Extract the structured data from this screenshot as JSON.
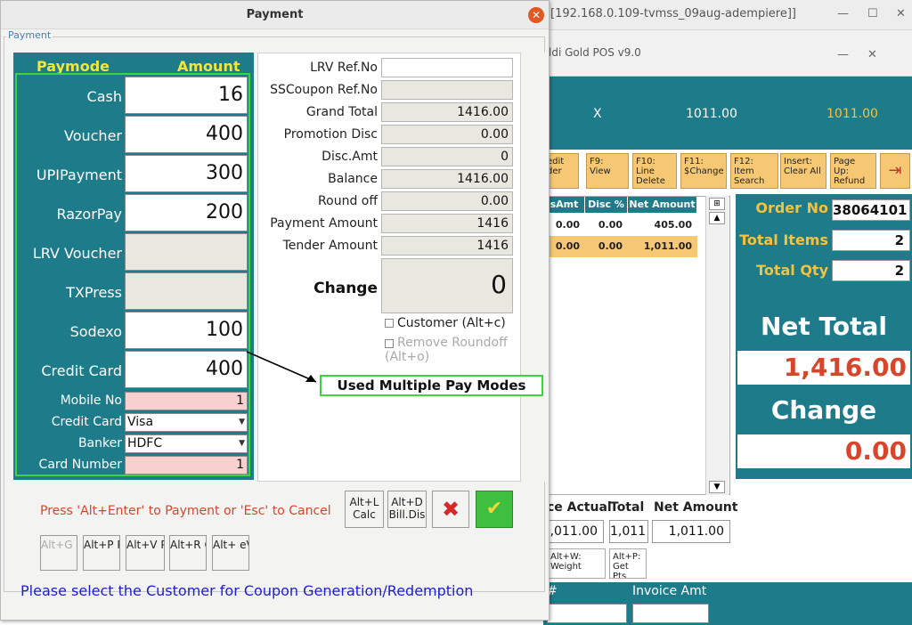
{
  "background_window": {
    "title": "[192.168.0.109-tvmss_09aug-adempiere]]",
    "subtitle": "ldi Gold POS v9.0",
    "band": {
      "x_label": "X",
      "value1": "1011.00",
      "value2": "1011.00"
    },
    "fkeys": [
      {
        "label": "edit der"
      },
      {
        "label": "F9: View"
      },
      {
        "label": "F10: Line Delete"
      },
      {
        "label": "F11: $Change"
      },
      {
        "label": "F12: Item Search"
      },
      {
        "label": "Insert: Clear All"
      },
      {
        "label": "Page Up: Refund"
      }
    ],
    "grid": {
      "headers": [
        "sAmt",
        "Disc %",
        "Net Amount"
      ],
      "rows": [
        [
          "0.00",
          "0.00",
          "405.00"
        ],
        [
          "0.00",
          "0.00",
          "1,011.00"
        ]
      ]
    },
    "order_no_label": "Order No",
    "order_no": "38064101",
    "total_items_label": "Total Items",
    "total_items": "2",
    "total_qty_label": "Total Qty",
    "total_qty": "2",
    "net_total_label": "Net Total",
    "net_total": "1,416.00",
    "change_label": "Change",
    "change_value": "0.00",
    "bottom_labels": [
      "ce Actual",
      "Total",
      "Net Amount"
    ],
    "bottom_values": [
      ",011.00",
      "1,011",
      "1,011.00"
    ],
    "small_buttons": [
      {
        "label": "Alt+W: Weight"
      },
      {
        "label": "Alt+P: Get Pts"
      }
    ],
    "bottom_bar_labels": [
      "#",
      "Invoice Amt"
    ]
  },
  "dialog": {
    "title": "Payment",
    "group_title": "Payment",
    "col_paymode": "Paymode",
    "col_amount": "Amount",
    "paymodes": [
      {
        "label": "Cash",
        "value": "16",
        "editable": true
      },
      {
        "label": "Voucher",
        "value": "400",
        "editable": true
      },
      {
        "label": "UPIPayment",
        "value": "300",
        "editable": true
      },
      {
        "label": "RazorPay",
        "value": "200",
        "editable": true
      },
      {
        "label": "LRV Voucher",
        "value": "",
        "editable": false
      },
      {
        "label": "TXPress",
        "value": "",
        "editable": false
      },
      {
        "label": "Sodexo",
        "value": "100",
        "editable": true
      },
      {
        "label": "Credit Card",
        "value": "400",
        "editable": true
      }
    ],
    "mobile_no_label": "Mobile No",
    "mobile_no": "1",
    "credit_card_label": "Credit Card",
    "credit_card_value": "Visa",
    "banker_label": "Banker",
    "banker_value": "HDFC",
    "card_number_label": "Card Number",
    "card_number": "1",
    "info_fields": [
      {
        "label": "LRV Ref.No",
        "value": "",
        "white": true
      },
      {
        "label": "SSCoupon Ref.No",
        "value": "",
        "white": false
      },
      {
        "label": "Grand Total",
        "value": "1416.00",
        "white": false
      },
      {
        "label": "Promotion Disc",
        "value": "0.00",
        "white": false
      },
      {
        "label": "Disc.Amt",
        "value": "0",
        "white": false
      },
      {
        "label": "Balance",
        "value": "1416.00",
        "white": false
      },
      {
        "label": "Round off",
        "value": "0.00",
        "white": false
      },
      {
        "label": "Payment Amount",
        "value": "1416",
        "white": false
      },
      {
        "label": "Tender Amount",
        "value": "1416",
        "white": false
      }
    ],
    "change_label": "Change",
    "change_value": "0",
    "customer_checkbox": "Customer (Alt+c)",
    "remove_roundoff_checkbox": "Remove Roundoff (Alt+o)",
    "callout": "Used Multiple Pay Modes",
    "hint": "Press 'Alt+Enter' to Payment or 'Esc' to Cancel",
    "calc_button": "Alt+L Calc",
    "billdisc_button": "Alt+D Bill.Dis",
    "mini_buttons": [
      {
        "label": "Alt+G Gift C",
        "disabled": true
      },
      {
        "label": "Alt+P PayTM",
        "disabled": false
      },
      {
        "label": "Alt+V Pts.Re",
        "disabled": false
      },
      {
        "label": "Alt+R CP.Rd",
        "disabled": false
      },
      {
        "label": "Alt+ eVouc",
        "disabled": false
      }
    ],
    "status_message": "Please select the Customer for Coupon Generation/Redemption"
  },
  "colors": {
    "teal": "#1e7b8a",
    "yellow_header": "#f2e63a",
    "highlight_green": "#3fd43f",
    "accent_red": "#d9452b",
    "status_blue": "#1c1cdc",
    "fkey_orange": "#f7c873"
  },
  "icons": {
    "dialog_close": "close-circle-icon",
    "cancel": "red-x-icon",
    "ok": "green-check-icon",
    "exit": "exit-door-icon"
  }
}
